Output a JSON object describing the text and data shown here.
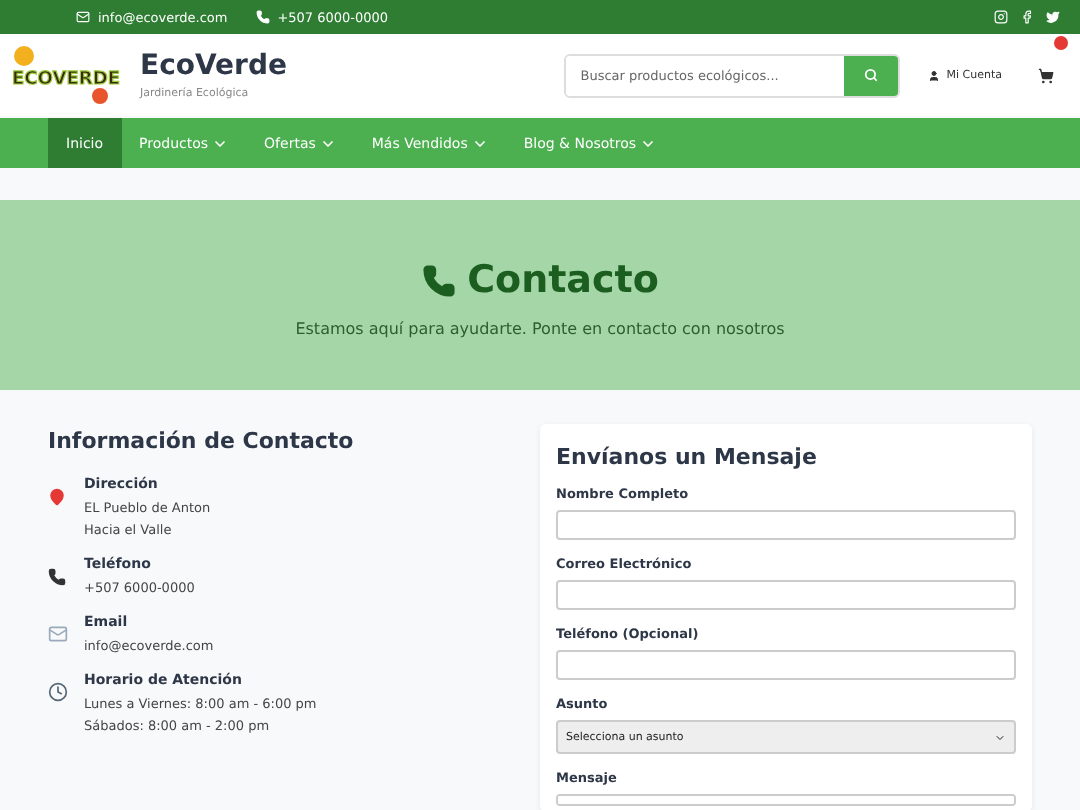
{
  "topbar": {
    "email": "info@ecoverde.com",
    "phone": "+507 6000-0000"
  },
  "header": {
    "logo_text": "ECOVERDE",
    "brand": "EcoVerde",
    "tagline": "Jardinería Ecológica",
    "search": {
      "placeholder": "Buscar productos ecológicos..."
    },
    "account": "Mi Cuenta"
  },
  "nav": [
    {
      "label": "Inicio",
      "selected": true,
      "dropdown": false
    },
    {
      "label": "Productos",
      "selected": false,
      "dropdown": true
    },
    {
      "label": "Ofertas",
      "selected": false,
      "dropdown": true
    },
    {
      "label": "Más Vendidos",
      "selected": false,
      "dropdown": true
    },
    {
      "label": "Blog & Nosotros",
      "selected": false,
      "dropdown": true
    }
  ],
  "hero": {
    "title": "Contacto",
    "subtitle": "Estamos aquí para ayudarte. Ponte en contacto con nosotros"
  },
  "contact_info": {
    "title": "Información de Contacto",
    "items": [
      {
        "kind": "pin",
        "label": "Dirección",
        "lines": [
          "EL Pueblo de Anton",
          "Hacia el Valle"
        ]
      },
      {
        "kind": "phone",
        "label": "Teléfono",
        "lines": [
          "+507 6000-0000"
        ]
      },
      {
        "kind": "mail",
        "label": "Email",
        "lines": [
          "info@ecoverde.com"
        ]
      },
      {
        "kind": "clock",
        "label": "Horario de Atención",
        "lines": [
          "Lunes a Viernes: 8:00 am - 6:00 pm",
          "Sábados: 8:00 am - 2:00 pm"
        ]
      }
    ]
  },
  "form": {
    "title": "Envíanos un Mensaje",
    "fields": [
      {
        "kind": "input",
        "label": "Nombre Completo"
      },
      {
        "kind": "input",
        "label": "Correo Electrónico"
      },
      {
        "kind": "input",
        "label": "Teléfono (Opcional)"
      },
      {
        "kind": "select",
        "label": "Asunto",
        "value": "Selecciona un asunto"
      },
      {
        "kind": "textarea",
        "label": "Mensaje"
      }
    ]
  }
}
